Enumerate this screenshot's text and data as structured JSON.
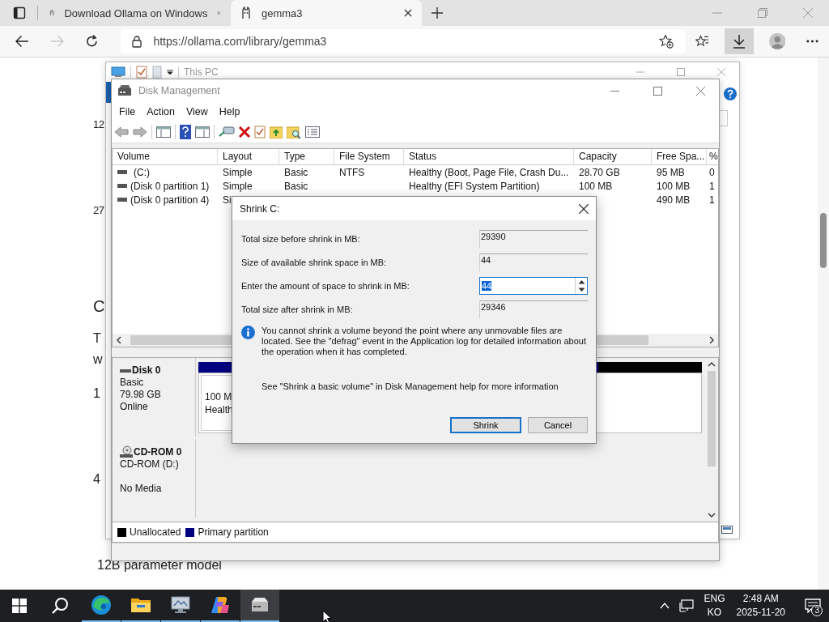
{
  "browser": {
    "tabs": [
      {
        "title": "Download Ollama on Windows",
        "selected": false
      },
      {
        "title": "gemma3",
        "selected": true
      }
    ],
    "url": "https://ollama.com/library/gemma3"
  },
  "page": {
    "fragments": [
      "12",
      "27",
      "C",
      "T",
      "w",
      "1",
      "4"
    ],
    "heading": "12B parameter model"
  },
  "this_pc": {
    "title": "This PC"
  },
  "disk_management": {
    "title": "Disk Management",
    "menu": [
      "File",
      "Action",
      "View",
      "Help"
    ],
    "columns": [
      "Volume",
      "Layout",
      "Type",
      "File System",
      "Status",
      "Capacity",
      "Free Spa...",
      "%"
    ],
    "rows": [
      {
        "cells": [
          "(C:)",
          "Simple",
          "Basic",
          "NTFS",
          "Healthy (Boot, Page File, Crash Du...",
          "28.70 GB",
          "95 MB",
          "0"
        ]
      },
      {
        "cells": [
          "(Disk 0 partition 1)",
          "Simple",
          "Basic",
          null,
          "Healthy (EFI System Partition)",
          "100 MB",
          "100 MB",
          "1"
        ]
      },
      {
        "cells": [
          "(Disk 0 partition 4)",
          "Si",
          null,
          null,
          null,
          null,
          "490 MB",
          "1"
        ]
      }
    ],
    "disks": [
      {
        "kind": "disk",
        "name": "Disk 0",
        "lines": [
          "Basic",
          "79.98 GB",
          "Online"
        ],
        "partition": {
          "size": "100 M",
          "status": "Health"
        }
      },
      {
        "kind": "cdrom",
        "name": "CD-ROM 0",
        "lines": [
          "CD-ROM (D:)",
          "No Media"
        ]
      }
    ],
    "legend": [
      {
        "label": "Unallocated",
        "color": "#000000"
      },
      {
        "label": "Primary partition",
        "color": "#000080"
      }
    ]
  },
  "dialog": {
    "title": "Shrink C:",
    "fields": [
      {
        "kind": "readonly",
        "label": "Total size before shrink in MB:",
        "value": "29390"
      },
      {
        "kind": "readonly",
        "label": "Size of available shrink space in MB:",
        "value": "44"
      },
      {
        "kind": "spin",
        "label": "Enter the amount of space to shrink in MB:",
        "value": "44",
        "text_selected": true
      },
      {
        "kind": "readonly",
        "label": "Total size after shrink in MB:",
        "value": "29346"
      }
    ],
    "info": "You cannot shrink a volume beyond the point where any unmovable files are located. See the \"defrag\" event in the Application log for detailed information about the operation when it has completed.",
    "help": "See \"Shrink a basic volume\" in Disk Management help for more information",
    "buttons": [
      {
        "label": "Shrink",
        "default": true
      },
      {
        "label": "Cancel",
        "default": false
      }
    ]
  },
  "taskbar": {
    "apps": [
      {
        "kind": "edge",
        "running": true,
        "active": false
      },
      {
        "kind": "explorer",
        "running": true,
        "active": false
      },
      {
        "kind": "remote",
        "running": true,
        "active": false
      },
      {
        "kind": "copilot",
        "running": true,
        "active": false
      },
      {
        "kind": "disk",
        "running": true,
        "active": true
      }
    ],
    "language": "ENG",
    "layout": "KO",
    "time": "2:48 AM",
    "date": "2025-11-20",
    "notifications": "3"
  }
}
